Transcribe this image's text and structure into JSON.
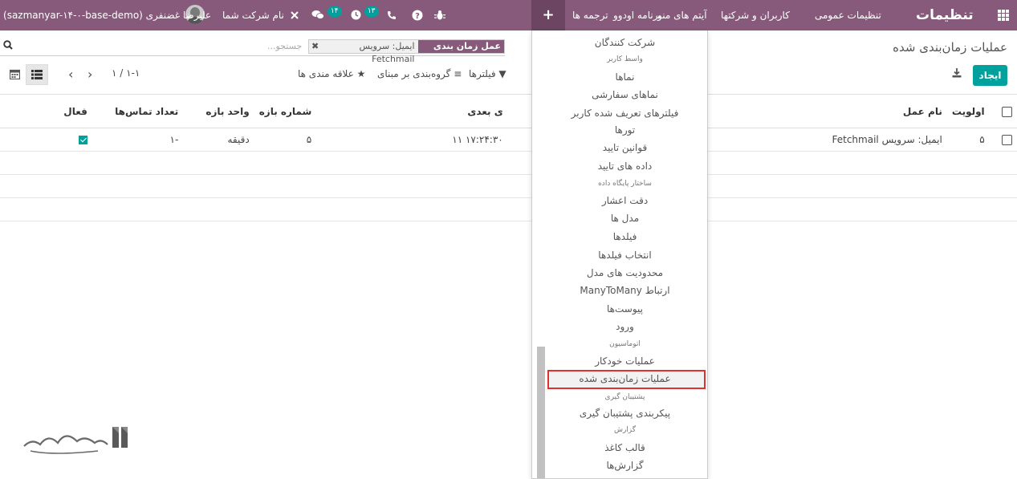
{
  "topbar": {
    "brand": "تنظیمات",
    "menus": [
      "تنظیمات عمومی",
      "کاربران و شرکتها",
      "آیتم های منو",
      "برنامه اودوو",
      "ترجمه ها"
    ],
    "plus": "+",
    "activity_badge": "۱۳",
    "chat_badge": "۱۴",
    "company": "نام شرکت شما",
    "user": "علیرضا غضنفری (sazmanyar-۱۴-۰-base-demo)"
  },
  "page": {
    "title": "عملیات زمان‌بندی شده",
    "create_label": "ایجاد"
  },
  "search": {
    "facet_label": "عمل زمان بندی شده",
    "facet_value": "ایمیل: سرویس Fetchmail",
    "placeholder": "جستجو..."
  },
  "controls": {
    "filters": "فیلترها",
    "groupby": "گروه‌بندی بر مبنای",
    "favorites": "علاقه مندی ها",
    "pager": "۱-۱ / ۱"
  },
  "table": {
    "headers": {
      "priority": "اولویت",
      "name": "نام عمل",
      "next": "ی بعدی",
      "interval_number": "شماره بازه",
      "interval_unit": "واحد بازه",
      "calls": "تعداد تماس‌ها",
      "active": "فعال"
    },
    "rows": [
      {
        "priority": "۵",
        "name": "ایمیل: سرویس Fetchmail",
        "next": "۱۷:۲۴:۳۰ ۱۱",
        "interval_number": "۵",
        "interval_unit": "دقیقه",
        "calls": "-۱"
      }
    ]
  },
  "dropdown": {
    "items": [
      {
        "type": "link",
        "label": "شرکت کنندگان"
      },
      {
        "type": "head",
        "label": "واسط کاربر"
      },
      {
        "type": "link",
        "label": "نماها"
      },
      {
        "type": "link",
        "label": "نماهای سفارشی"
      },
      {
        "type": "link",
        "label": "فیلترهای تعریف شده کاربر"
      },
      {
        "type": "link",
        "label": "تورها"
      },
      {
        "type": "link",
        "label": "قوانین تایید"
      },
      {
        "type": "link",
        "label": "داده های تایید"
      },
      {
        "type": "head",
        "label": "ساختار پایگاه داده"
      },
      {
        "type": "link",
        "label": "دقت اعشار"
      },
      {
        "type": "link",
        "label": "مدل ها"
      },
      {
        "type": "link",
        "label": "فیلدها"
      },
      {
        "type": "link",
        "label": "انتخاب فیلدها"
      },
      {
        "type": "link",
        "label": "محدودیت های مدل"
      },
      {
        "type": "link",
        "label": "ارتباط ManyToMany"
      },
      {
        "type": "link",
        "label": "پیوست‌ها"
      },
      {
        "type": "link",
        "label": "ورود"
      },
      {
        "type": "head",
        "label": "اتوماسیون"
      },
      {
        "type": "link",
        "label": "عملیات خودکار"
      },
      {
        "type": "link",
        "label": "عملیات زمان‌بندی شده"
      },
      {
        "type": "head",
        "label": "پشتیبان گیری"
      },
      {
        "type": "link",
        "label": "پیکربندی پشتیبان گیری"
      },
      {
        "type": "head",
        "label": "گزارش"
      },
      {
        "type": "link",
        "label": "قالب کاغذ"
      },
      {
        "type": "link",
        "label": "گزارش‌ها"
      }
    ]
  },
  "colors": {
    "primary": "#875a7b",
    "accent": "#00a09d",
    "highlight": "#e03030"
  }
}
